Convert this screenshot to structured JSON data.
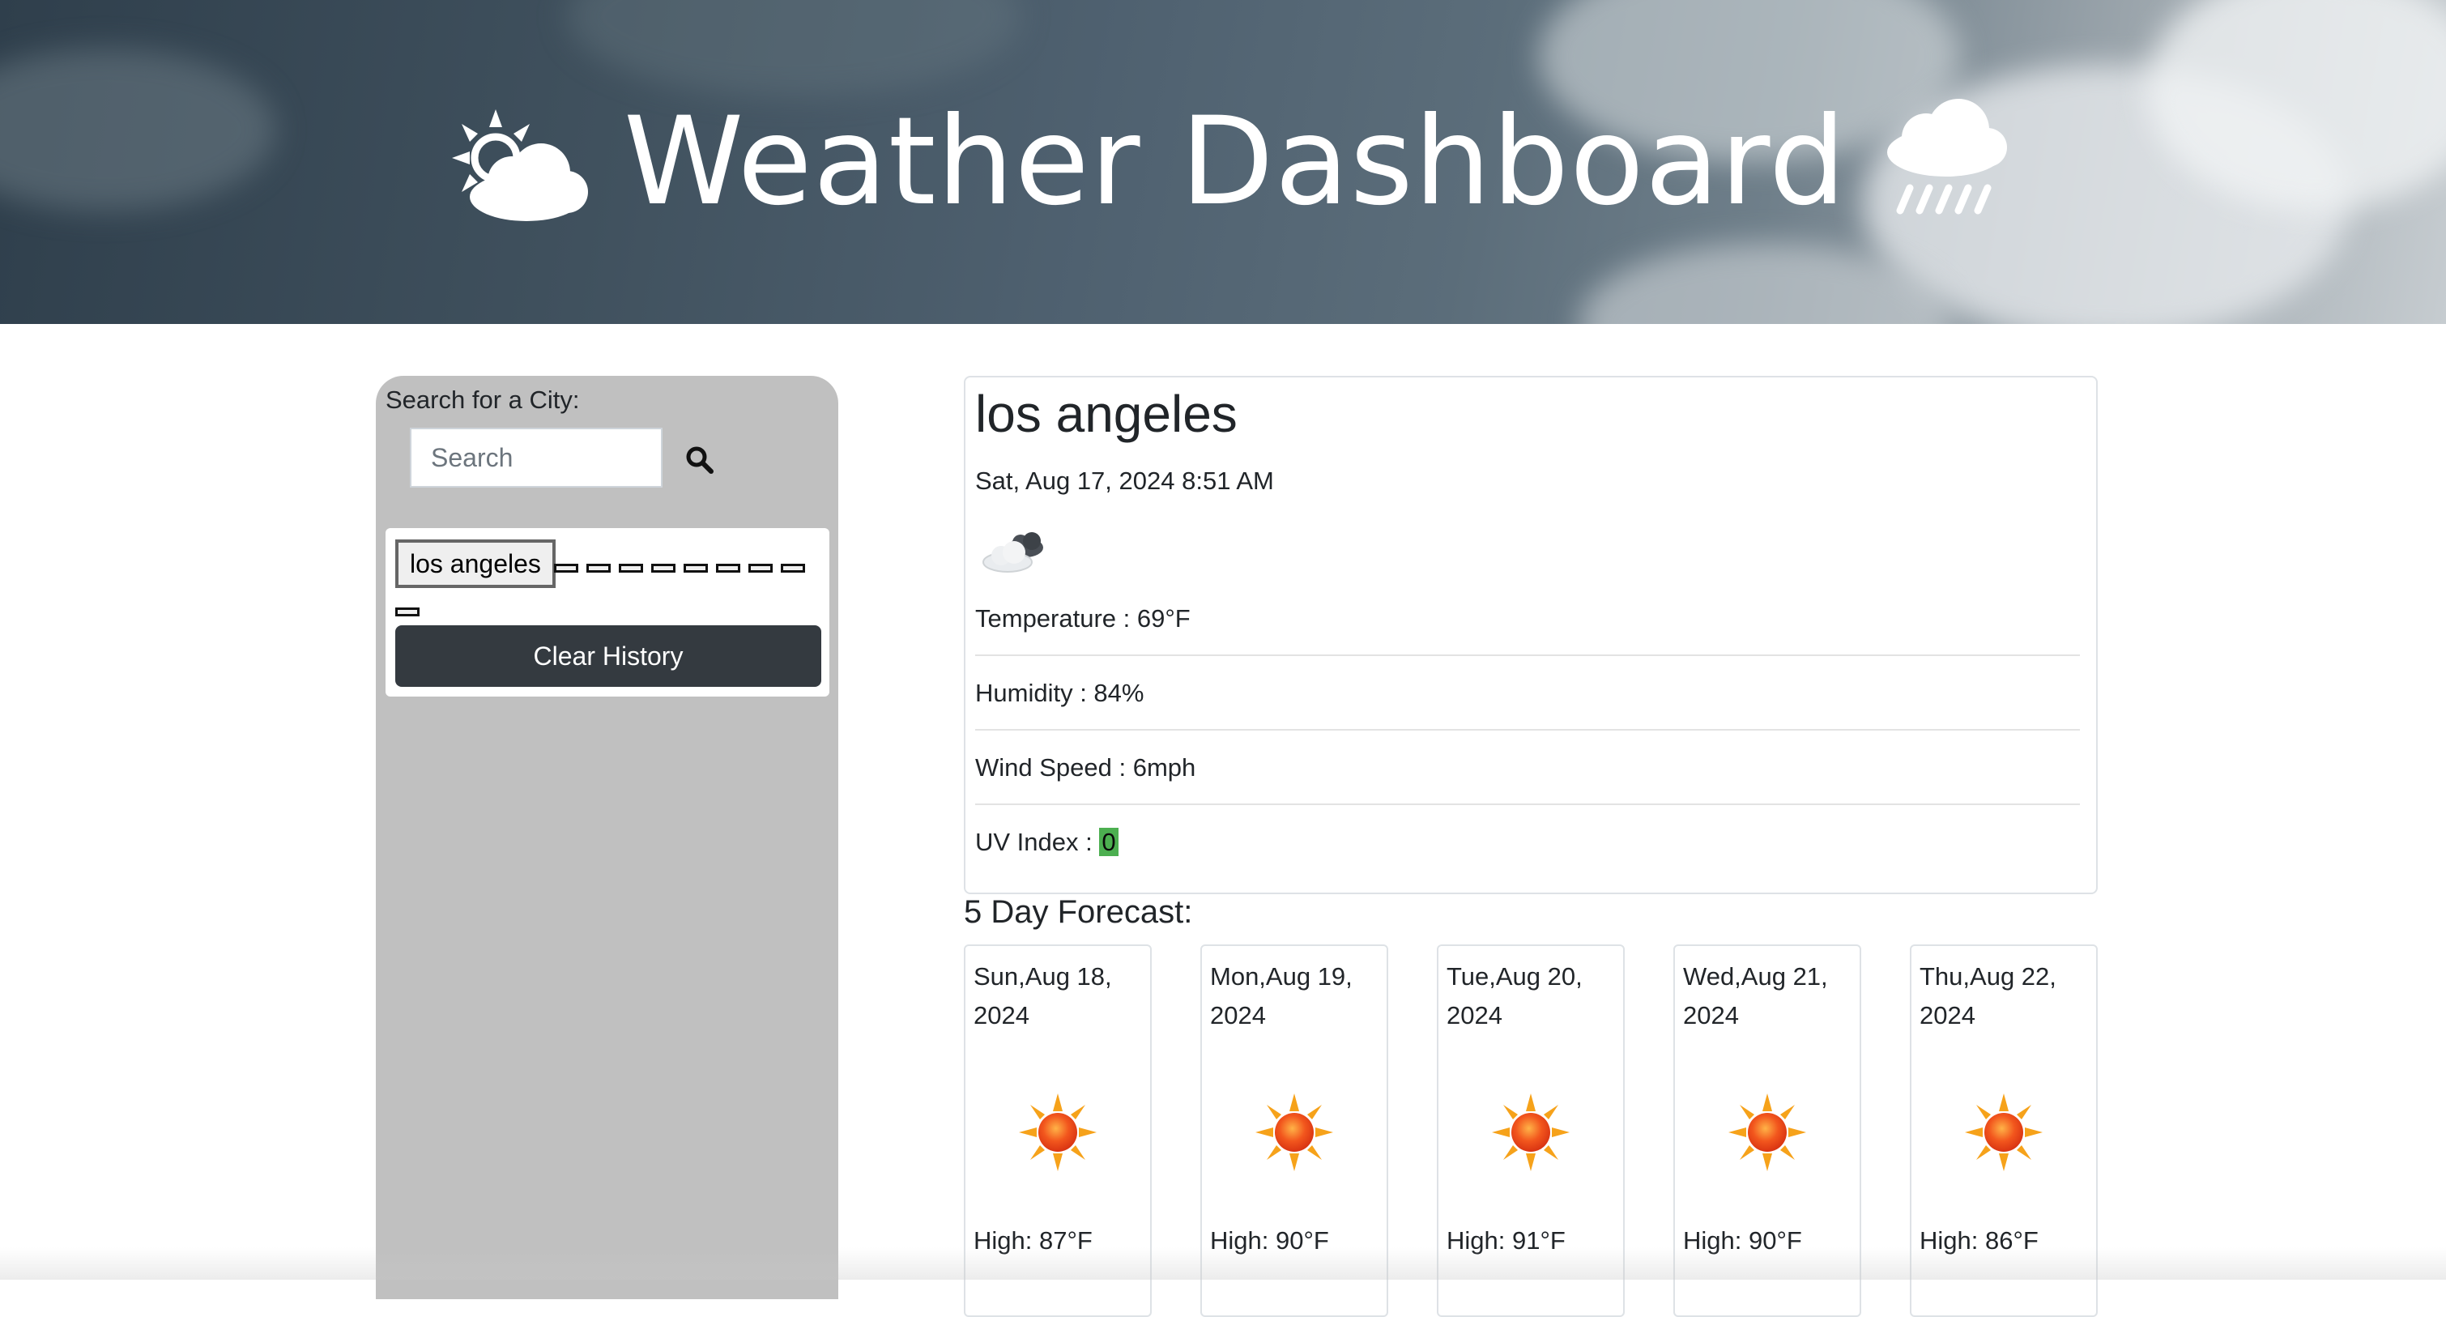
{
  "header": {
    "title": "Weather Dashboard",
    "left_icon": "sun-behind-cloud-icon",
    "right_icon": "rain-cloud-icon"
  },
  "sidebar": {
    "search_label": "Search for a City:",
    "search_placeholder": "Search",
    "search_value": "",
    "search_icon": "search-icon",
    "history": [
      "los angeles"
    ],
    "clear_label": "Clear History"
  },
  "current": {
    "city": "los angeles",
    "datetime": "Sat, Aug 17, 2024 8:51 AM",
    "icon": "partly-cloudy-icon",
    "temperature": "Temperature : 69°F",
    "humidity": "Humidity : 84%",
    "wind": "Wind Speed : 6mph",
    "uv_label": "UV Index : ",
    "uv_value": "0",
    "uv_color": "#4caf50"
  },
  "forecast": {
    "title": "5 Day Forecast:",
    "days": [
      {
        "date": "Sun,Aug 18, 2024",
        "icon": "sun-icon",
        "high": "High: 87°F"
      },
      {
        "date": "Mon,Aug 19, 2024",
        "icon": "sun-icon",
        "high": "High: 90°F"
      },
      {
        "date": "Tue,Aug 20, 2024",
        "icon": "sun-icon",
        "high": "High: 91°F"
      },
      {
        "date": "Wed,Aug 21, 2024",
        "icon": "sun-icon",
        "high": "High: 90°F"
      },
      {
        "date": "Thu,Aug 22, 2024",
        "icon": "sun-icon",
        "high": "High: 86°F"
      }
    ]
  },
  "colors": {
    "sidebar_bg": "#c0c0c0",
    "clear_button_bg": "#343a40",
    "sun_core": "#e8401c",
    "sun_rays": "#f6a21a"
  }
}
